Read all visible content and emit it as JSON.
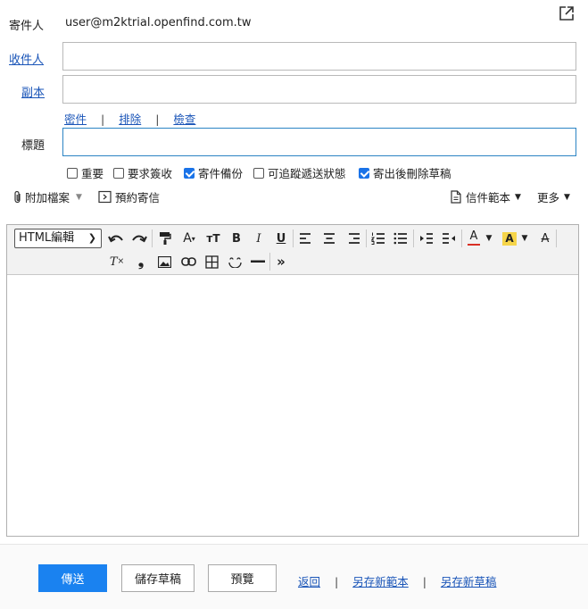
{
  "header": {
    "sender_label": "寄件人",
    "sender_value": "user@m2ktrial.openfind.com.tw"
  },
  "fields": {
    "to_label": "收件人",
    "cc_label": "副本",
    "subject_label": "標題",
    "to_value": "",
    "cc_value": "",
    "subject_value": ""
  },
  "recipient_links": {
    "bcc": "密件",
    "exclude": "排除",
    "check": "檢查",
    "separator": "|"
  },
  "options": {
    "important": {
      "label": "重要",
      "checked": false
    },
    "request_receipt": {
      "label": "要求簽收",
      "checked": false
    },
    "backup": {
      "label": "寄件備份",
      "checked": true
    },
    "track": {
      "label": "可追蹤遞送狀態",
      "checked": false
    },
    "delete_draft": {
      "label": "寄出後刪除草稿",
      "checked": true
    }
  },
  "actions_bar": {
    "attach_label": "附加檔案",
    "schedule_label": "預約寄信",
    "template_label": "信件範本",
    "more_label": "更多"
  },
  "editor": {
    "mode_value": "HTML編輯",
    "icons": [
      "undo-icon",
      "redo-icon",
      "format-painter-icon",
      "font-size-icon",
      "remove-format-size-icon",
      "bold-icon",
      "italic-icon",
      "underline-icon",
      "align-left-icon",
      "align-center-icon",
      "align-right-icon",
      "ordered-list-icon",
      "unordered-list-icon",
      "indent-icon",
      "outdent-icon",
      "text-color-icon",
      "highlight-color-icon",
      "strikethrough-icon",
      "clear-format-icon",
      "quote-icon",
      "image-icon",
      "link-icon",
      "table-icon",
      "emoji-icon",
      "horizontal-rule-icon",
      "more-tools-icon"
    ],
    "text_color": "#d93025",
    "highlight_color": "#f6d54a"
  },
  "footer": {
    "send_label": "傳送",
    "save_draft_label": "儲存草稿",
    "preview_label": "預覽",
    "back_label": "返回",
    "save_template_label": "另存新範本",
    "save_new_draft_label": "另存新草稿",
    "separator": "|"
  },
  "colors": {
    "link": "#1a55b8",
    "primary": "#1a82f0",
    "focus_border": "#2b84c4"
  }
}
